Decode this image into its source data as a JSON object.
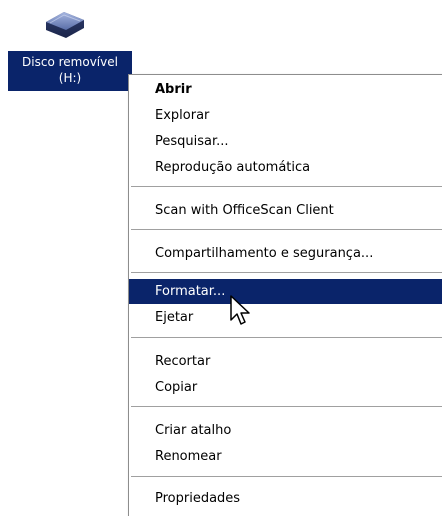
{
  "desktop": {
    "drive": {
      "icon": "removable-drive-icon",
      "label_line1": "Disco removível",
      "label_line2": "(H:)"
    }
  },
  "context_menu": {
    "highlight_color": "#0a246a",
    "items": [
      {
        "label": "Abrir"
      },
      {
        "label": "Explorar"
      },
      {
        "label": "Pesquisar..."
      },
      {
        "label": "Reprodução automática"
      },
      {
        "label": "Scan with OfficeScan Client"
      },
      {
        "label": "Compartilhamento e segurança..."
      },
      {
        "label": "Formatar..."
      },
      {
        "label": "Ejetar"
      },
      {
        "label": "Recortar"
      },
      {
        "label": "Copiar"
      },
      {
        "label": "Criar atalho"
      },
      {
        "label": "Renomear"
      },
      {
        "label": "Propriedades"
      }
    ]
  },
  "cursor": {
    "icon": "arrow-cursor-icon"
  }
}
